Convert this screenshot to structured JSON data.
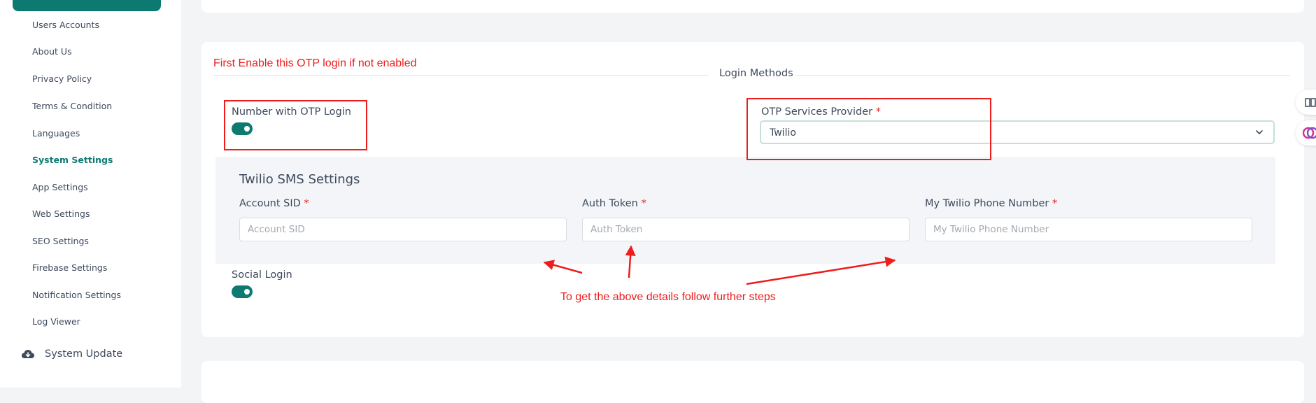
{
  "sidebar": {
    "sub_items": [
      {
        "label": "Users Accounts",
        "active": false
      },
      {
        "label": "About Us",
        "active": false
      },
      {
        "label": "Privacy Policy",
        "active": false
      },
      {
        "label": "Terms & Condition",
        "active": false
      },
      {
        "label": "Languages",
        "active": false
      },
      {
        "label": "System Settings",
        "active": true
      },
      {
        "label": "App Settings",
        "active": false
      },
      {
        "label": "Web Settings",
        "active": false
      },
      {
        "label": "SEO Settings",
        "active": false
      },
      {
        "label": "Firebase Settings",
        "active": false
      },
      {
        "label": "Notification Settings",
        "active": false
      },
      {
        "label": "Log Viewer",
        "active": false
      }
    ],
    "system_update": {
      "label": "System Update",
      "icon": "cloud-download-icon"
    }
  },
  "annotations": {
    "enable_otp_note": "First Enable this OTP login if not enabled",
    "follow_steps_note": "To get the above details follow further steps",
    "color": "#ee1c1c"
  },
  "login_methods": {
    "legend": "Login Methods",
    "otp_login": {
      "label": "Number with OTP Login",
      "enabled": true
    },
    "otp_provider": {
      "label": "OTP Services Provider",
      "required_mark": "*",
      "selected": "Twilio"
    },
    "social_login": {
      "label": "Social Login",
      "enabled": true
    }
  },
  "twilio": {
    "title": "Twilio SMS Settings",
    "fields": [
      {
        "label": "Account SID",
        "required_mark": "*",
        "placeholder": "Account SID",
        "value": ""
      },
      {
        "label": "Auth Token",
        "required_mark": "*",
        "placeholder": "Auth Token",
        "value": ""
      },
      {
        "label": "My Twilio Phone Number",
        "required_mark": "*",
        "placeholder": "My Twilio Phone Number",
        "value": ""
      }
    ]
  },
  "colors": {
    "accent": "#0d7a72",
    "required": "#e02424"
  }
}
